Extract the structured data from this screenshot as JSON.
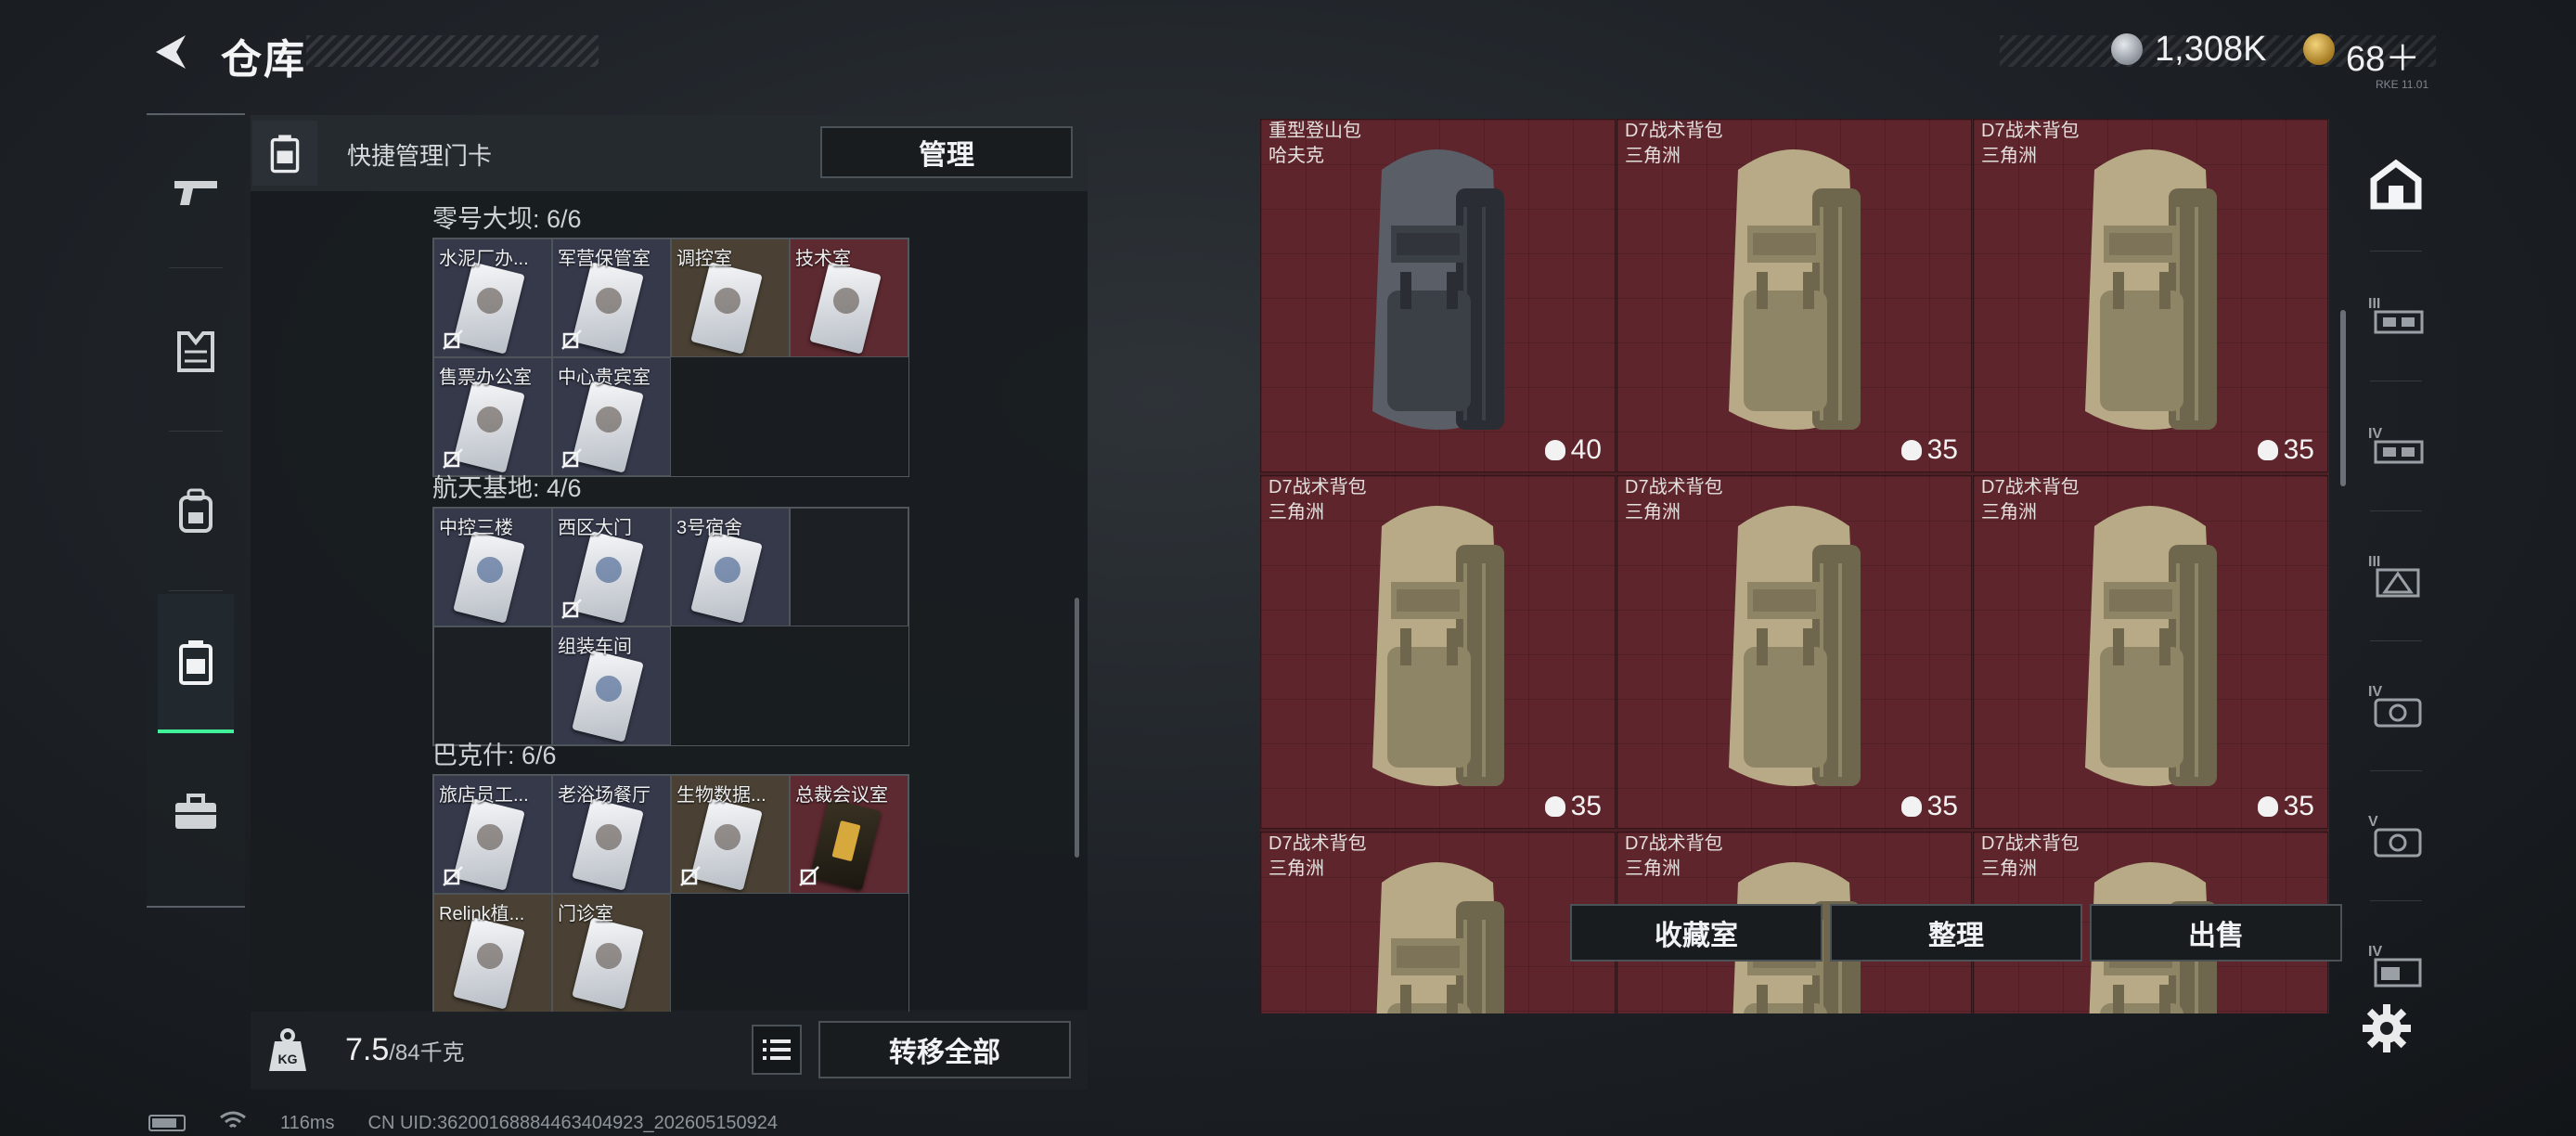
{
  "header": {
    "title": "仓库",
    "currency_silver": "1,308K",
    "currency_gold": "68＋",
    "version": "RKE 11.01"
  },
  "left_rail": {
    "tabs": [
      "weapons",
      "armor",
      "backpack",
      "keycards",
      "toolbox"
    ],
    "selected": "keycards"
  },
  "keycard_panel": {
    "title": "快捷管理门卡",
    "manage_label": "管理",
    "groups": [
      {
        "title": "零号大坝: 6/6",
        "rows": [
          [
            {
              "label": "水泥厂办...",
              "color": "gray",
              "unlinked": true
            },
            {
              "label": "军营保管室",
              "color": "gray",
              "unlinked": true
            },
            {
              "label": "调控室",
              "color": "brown",
              "unlinked": false
            },
            {
              "label": "技术室",
              "color": "red",
              "unlinked": false
            }
          ],
          [
            {
              "label": "售票办公室",
              "color": "gray",
              "unlinked": true
            },
            {
              "label": "中心贵宾室",
              "color": "gray",
              "unlinked": true
            }
          ]
        ]
      },
      {
        "title": "航天基地: 4/6",
        "rows": [
          [
            {
              "label": "中控三楼",
              "color": "gray",
              "unlinked": false
            },
            {
              "label": "西区大门",
              "color": "gray",
              "unlinked": true
            },
            {
              "label": "3号宿舍",
              "color": "gray",
              "unlinked": false
            },
            {
              "label": "",
              "color": "empty",
              "unlinked": false
            }
          ],
          [
            {
              "label": "",
              "color": "empty",
              "unlinked": false
            },
            {
              "label": "组装车间",
              "color": "gray",
              "unlinked": false
            }
          ]
        ]
      },
      {
        "title": "巴克什: 6/6",
        "rows": [
          [
            {
              "label": "旅店员工...",
              "color": "gray",
              "unlinked": true
            },
            {
              "label": "老浴场餐厅",
              "color": "gray",
              "unlinked": false
            },
            {
              "label": "生物数据...",
              "color": "brown",
              "unlinked": true
            },
            {
              "label": "总裁会议室",
              "color": "red",
              "unlinked": true
            }
          ],
          [
            {
              "label": "Relink植...",
              "color": "brown",
              "unlinked": false
            },
            {
              "label": "门诊室",
              "color": "brown",
              "unlinked": false
            }
          ]
        ]
      }
    ],
    "weight_current": "7.5",
    "weight_max": "/84千克",
    "transfer_label": "转移全部"
  },
  "storage": {
    "items": [
      {
        "name": "重型登山包",
        "sub": "哈夫克",
        "capacity": "40",
        "variant": "dark"
      },
      {
        "name": "D7战术背包",
        "sub": "三角洲",
        "capacity": "35",
        "variant": "tan"
      },
      {
        "name": "D7战术背包",
        "sub": "三角洲",
        "capacity": "35",
        "variant": "tan"
      },
      {
        "name": "D7战术背包",
        "sub": "三角洲",
        "capacity": "35",
        "variant": "tan"
      },
      {
        "name": "D7战术背包",
        "sub": "三角洲",
        "capacity": "35",
        "variant": "tan"
      },
      {
        "name": "D7战术背包",
        "sub": "三角洲",
        "capacity": "35",
        "variant": "tan"
      },
      {
        "name": "D7战术背包",
        "sub": "三角洲",
        "capacity": "",
        "variant": "tan"
      },
      {
        "name": "D7战术背包",
        "sub": "三角洲",
        "capacity": "",
        "variant": "tan"
      },
      {
        "name": "D7战术背包",
        "sub": "三角洲",
        "capacity": "",
        "variant": "tan"
      }
    ],
    "buttons": {
      "collection": "收藏室",
      "organize": "整理",
      "sell": "出售"
    }
  },
  "right_rail": {
    "items": [
      "home-icon",
      "III",
      "IV",
      "III",
      "IV",
      "V",
      "IV"
    ]
  },
  "status_bar": {
    "ping": "116ms",
    "uid": "CN UID:36200168884463404923_202605150924"
  },
  "colors": {
    "accent_green": "#3ff29a",
    "storage_red": "#5e252c",
    "panel_dark": "#181c20"
  }
}
